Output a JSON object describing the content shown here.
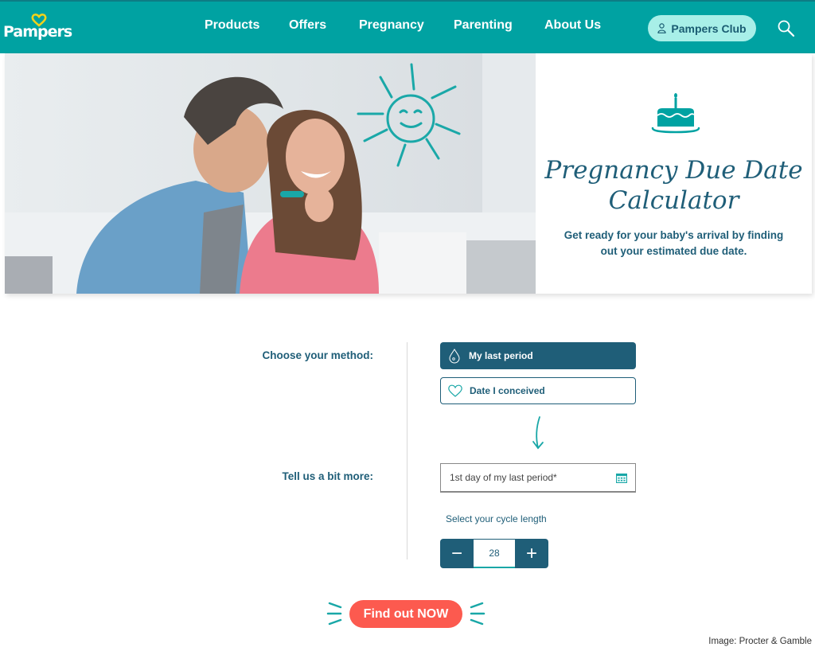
{
  "header": {
    "logo_text": "Pampers",
    "nav": [
      "Products",
      "Offers",
      "Pregnancy",
      "Parenting",
      "About Us"
    ],
    "club_button": "Pampers Club",
    "search_icon": "search-icon"
  },
  "hero": {
    "title_line1": "Pregnancy Due Date",
    "title_line2": "Calculator",
    "subtitle_line1": "Get ready for your baby's arrival by finding",
    "subtitle_line2": "out your estimated due date.",
    "icon": "cake-icon"
  },
  "form": {
    "method_label": "Choose your method:",
    "methods": [
      {
        "label": "My last period",
        "icon": "droplet-icon",
        "selected": true
      },
      {
        "label": "Date I conceived",
        "icon": "heart-icon",
        "selected": false
      }
    ],
    "more_label": "Tell us a bit more:",
    "date_placeholder": "1st day of my last period*",
    "cycle_label": "Select your cycle length",
    "cycle_value": "28",
    "minus": "−",
    "plus": "+",
    "submit": "Find out NOW"
  },
  "colors": {
    "header": "#00a2a2",
    "primary_dark": "#1f5e78",
    "club_bg": "#a8efe8",
    "cta": "#fc5a4f",
    "accent_teal": "#19a7a7"
  },
  "credit": "Image: Procter & Gamble"
}
